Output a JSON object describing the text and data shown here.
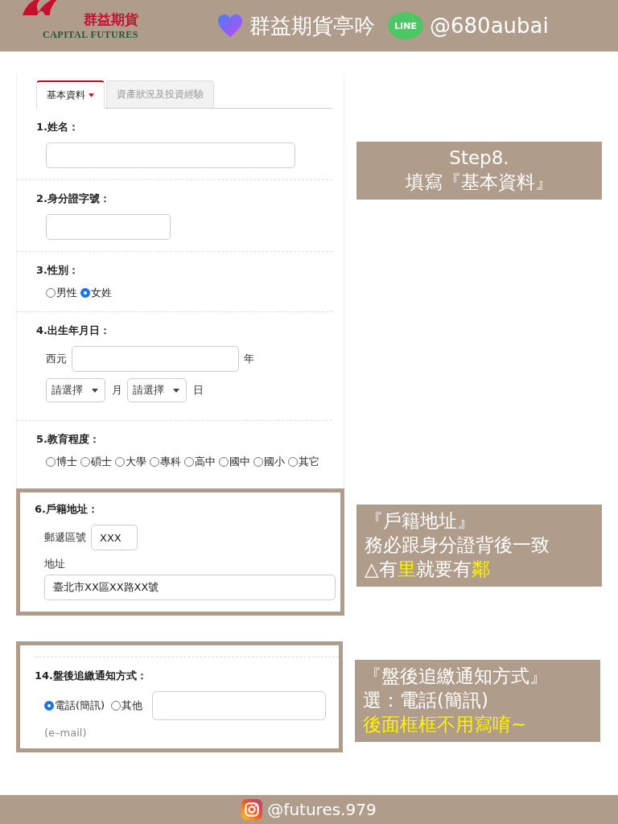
{
  "header": {
    "logo_cn": "群益期貨",
    "logo_en": "CAPITAL FUTURES",
    "title": "群益期貨亭吟",
    "line_label": "LINE",
    "line_id": "@680aubai"
  },
  "groups": [
    {
      "highlighted": false,
      "annotation": [
        [
          {
            "text": "Step8.",
            "highlight": false
          }
        ],
        [
          {
            "text": "填寫『基本資料』",
            "highlight": false
          }
        ]
      ],
      "tabs": [
        {
          "label": "基本資料",
          "selected": true
        },
        {
          "label": "資產狀況及投資經驗",
          "selected": false
        }
      ],
      "sections": [
        {
          "kind": "long_text",
          "label": "1.姓名："
        },
        {
          "kind": "short_text",
          "label": "2.身分證字號："
        },
        {
          "kind": "radio",
          "label": "3.性別：",
          "options": [
            {
              "label": "男性",
              "selected": false
            },
            {
              "label": "女姓",
              "selected": true
            }
          ]
        },
        {
          "kind": "date",
          "label": "4.出生年月日：",
          "prefix": "西元",
          "year_unit": "年",
          "selects": [
            {
              "value": "請選擇",
              "unit": "月"
            },
            {
              "value": "請選擇",
              "unit": "日"
            }
          ]
        },
        {
          "kind": "radio",
          "label": "5.教育程度：",
          "options": [
            {
              "label": "博士",
              "selected": false
            },
            {
              "label": "碩士",
              "selected": false
            },
            {
              "label": "大學",
              "selected": false
            },
            {
              "label": "專科",
              "selected": false
            },
            {
              "label": "高中",
              "selected": false
            },
            {
              "label": "國中",
              "selected": false
            },
            {
              "label": "國小",
              "selected": false
            },
            {
              "label": "其它",
              "selected": false
            }
          ]
        }
      ]
    },
    {
      "highlighted": true,
      "annotation": [
        [
          {
            "text": "『戶籍地址』",
            "highlight": false
          }
        ],
        [
          {
            "text": "務必跟身分證背後一致",
            "highlight": false
          }
        ],
        [
          {
            "text": "△有",
            "highlight": false
          },
          {
            "text": "里",
            "highlight": true
          },
          {
            "text": "就要有",
            "highlight": false
          },
          {
            "text": "鄰",
            "highlight": true
          }
        ]
      ],
      "sections": [
        {
          "kind": "address",
          "label": "6.戶籍地址：",
          "postal_label": "郵遞區號",
          "postal_value": "XXX",
          "address_label": "地址",
          "address_value": "臺北市XX區XX路XX號"
        }
      ]
    },
    {
      "highlighted": true,
      "annotation": [
        [
          {
            "text": "『盤後追繳通知方式』",
            "highlight": false
          }
        ],
        [
          {
            "text": "選：電話(簡訊)",
            "highlight": false
          }
        ],
        [
          {
            "text": "後面框框不用寫唷~",
            "highlight": true
          }
        ]
      ],
      "sections": [
        {
          "kind": "notify",
          "label": "14.盤後追繳通知方式：",
          "options": [
            {
              "label": "電話(簡訊)",
              "selected": true
            },
            {
              "label": "其他",
              "selected": false
            }
          ],
          "hint": "(e–mail)"
        }
      ]
    }
  ],
  "footer": {
    "handle": "@futures.979"
  }
}
